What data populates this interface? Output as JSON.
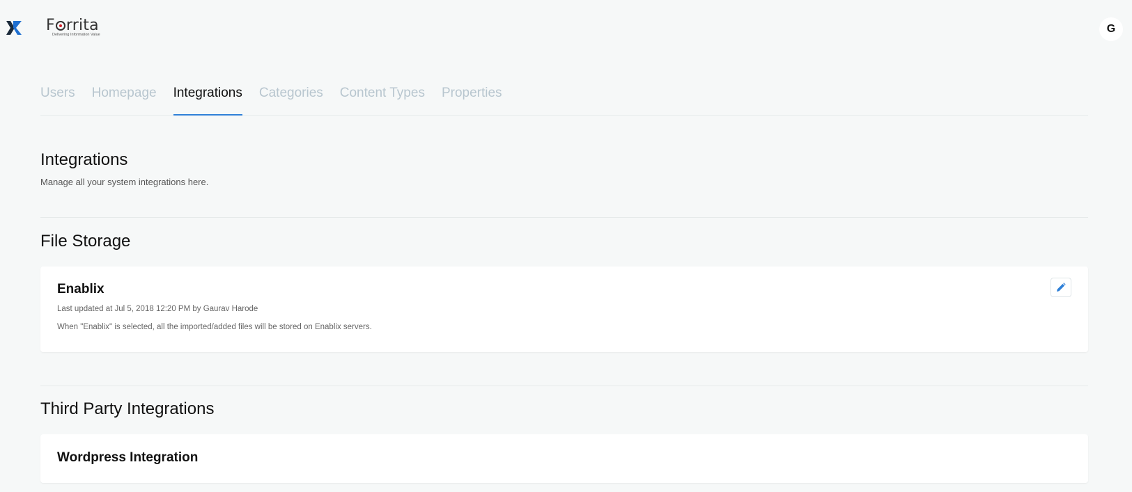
{
  "brand": {
    "name_prefix": "F",
    "name_suffix": "rrita",
    "tagline": "Delivering Information Value"
  },
  "user": {
    "avatar_initial": "G"
  },
  "tabs": [
    {
      "label": "Users",
      "active": false
    },
    {
      "label": "Homepage",
      "active": false
    },
    {
      "label": "Integrations",
      "active": true
    },
    {
      "label": "Categories",
      "active": false
    },
    {
      "label": "Content Types",
      "active": false
    },
    {
      "label": "Properties",
      "active": false
    }
  ],
  "page": {
    "title": "Integrations",
    "subtitle": "Manage all your system integrations here."
  },
  "file_storage": {
    "title": "File Storage",
    "card": {
      "name": "Enablix",
      "meta": "Last updated at Jul 5, 2018 12:20 PM by Gaurav Harode",
      "description": "When \"Enablix\" is selected, all the imported/added files will be stored on Enablix servers."
    }
  },
  "third_party": {
    "title": "Third Party Integrations",
    "cards": [
      {
        "name": "Wordpress Integration"
      }
    ]
  },
  "colors": {
    "background": "#f6f8f8",
    "accent": "#2f80d8",
    "tab_inactive": "#b8c6cf",
    "logo_blue": "#1f6fd0",
    "logo_dark": "#1b2a3a",
    "logo_dot": "#d0202a"
  }
}
